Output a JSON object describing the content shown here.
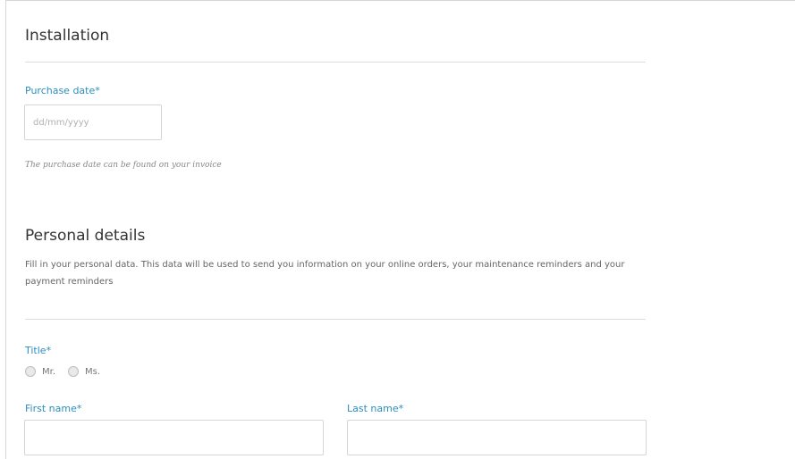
{
  "installation": {
    "title": "Installation",
    "purchase_date": {
      "label": "Purchase date*",
      "placeholder": "dd/mm/yyyy",
      "value": ""
    },
    "hint": "The purchase date can be found on your invoice"
  },
  "personal": {
    "title": "Personal details",
    "description": "Fill in your personal data. This data will be used to send you information on your online orders, your maintenance reminders and your payment reminders",
    "title_field": {
      "label": "Title*",
      "options": [
        {
          "label": "Mr.",
          "selected": false
        },
        {
          "label": "Ms.",
          "selected": false
        }
      ]
    },
    "first_name": {
      "label": "First name*",
      "value": ""
    },
    "last_name": {
      "label": "Last name*",
      "value": ""
    }
  },
  "colors": {
    "label_accent": "#2b8fc0",
    "divider": "#dedede",
    "border": "#d5d5d5"
  }
}
